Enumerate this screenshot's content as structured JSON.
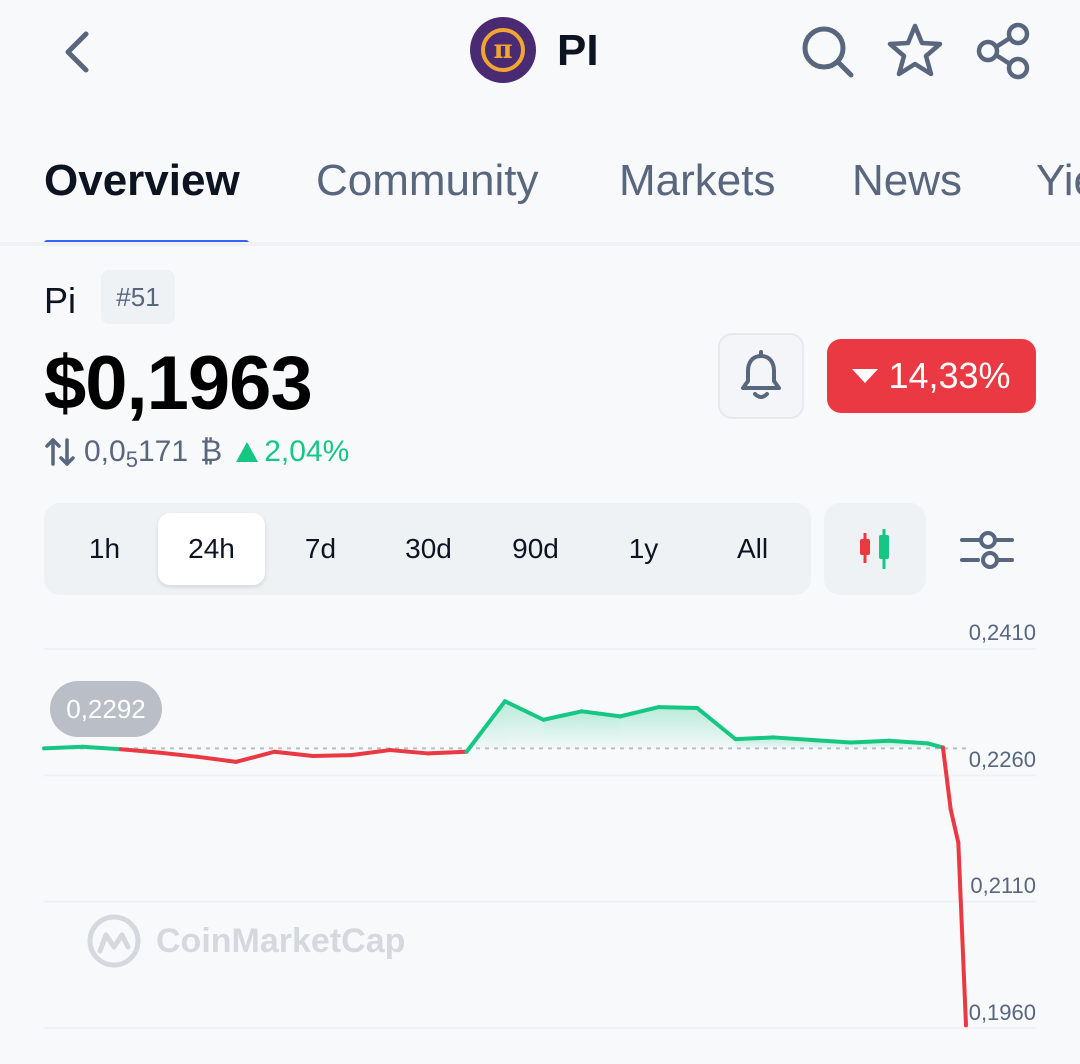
{
  "header": {
    "symbol": "PI",
    "logo_glyph": "π",
    "icons": [
      "back-arrow-icon",
      "search-icon",
      "star-icon",
      "share-icon"
    ]
  },
  "tabs": [
    {
      "label": "Overview",
      "active": true
    },
    {
      "label": "Community",
      "active": false
    },
    {
      "label": "Markets",
      "active": false
    },
    {
      "label": "News",
      "active": false
    },
    {
      "label": "Yie",
      "active": false
    }
  ],
  "coin": {
    "name": "Pi",
    "rank": "#51",
    "price": "$0,1963",
    "change_24h": "14,33%",
    "btc_price_prefix": "0,0",
    "btc_price_sub": "5",
    "btc_price_rest": "171",
    "btc_symbol": "₿",
    "btc_change": "2,04%"
  },
  "ranges": {
    "items": [
      "1h",
      "24h",
      "7d",
      "30d",
      "90d",
      "1y",
      "All"
    ],
    "selected": "24h"
  },
  "chart_data": {
    "type": "line",
    "reference_value": 0.2292,
    "reference_label": "0,2292",
    "y_tick_labels": [
      "0,2410",
      "0,2260",
      "0,2110",
      "0,1960"
    ],
    "ylim": [
      0.196,
      0.241
    ],
    "x_range_hours": 24,
    "up_color": "#16c784",
    "down_color": "#ea3943",
    "series": [
      {
        "x": [
          0,
          1,
          2,
          3,
          4,
          5,
          6,
          7,
          8,
          9,
          10,
          11,
          12,
          13,
          14,
          15,
          16,
          17,
          18,
          19,
          20,
          21,
          22,
          23,
          23.4,
          23.6,
          23.8,
          24
        ],
        "values": [
          0.2292,
          0.2294,
          0.2291,
          0.2287,
          0.2282,
          0.2276,
          0.2288,
          0.2283,
          0.2284,
          0.229,
          0.2286,
          0.2288,
          0.2348,
          0.2326,
          0.2336,
          0.233,
          0.2341,
          0.234,
          0.2303,
          0.2305,
          0.2302,
          0.2299,
          0.2301,
          0.2298,
          0.2293,
          0.222,
          0.218,
          0.1963
        ]
      }
    ]
  },
  "watermark": "CoinMarketCap"
}
